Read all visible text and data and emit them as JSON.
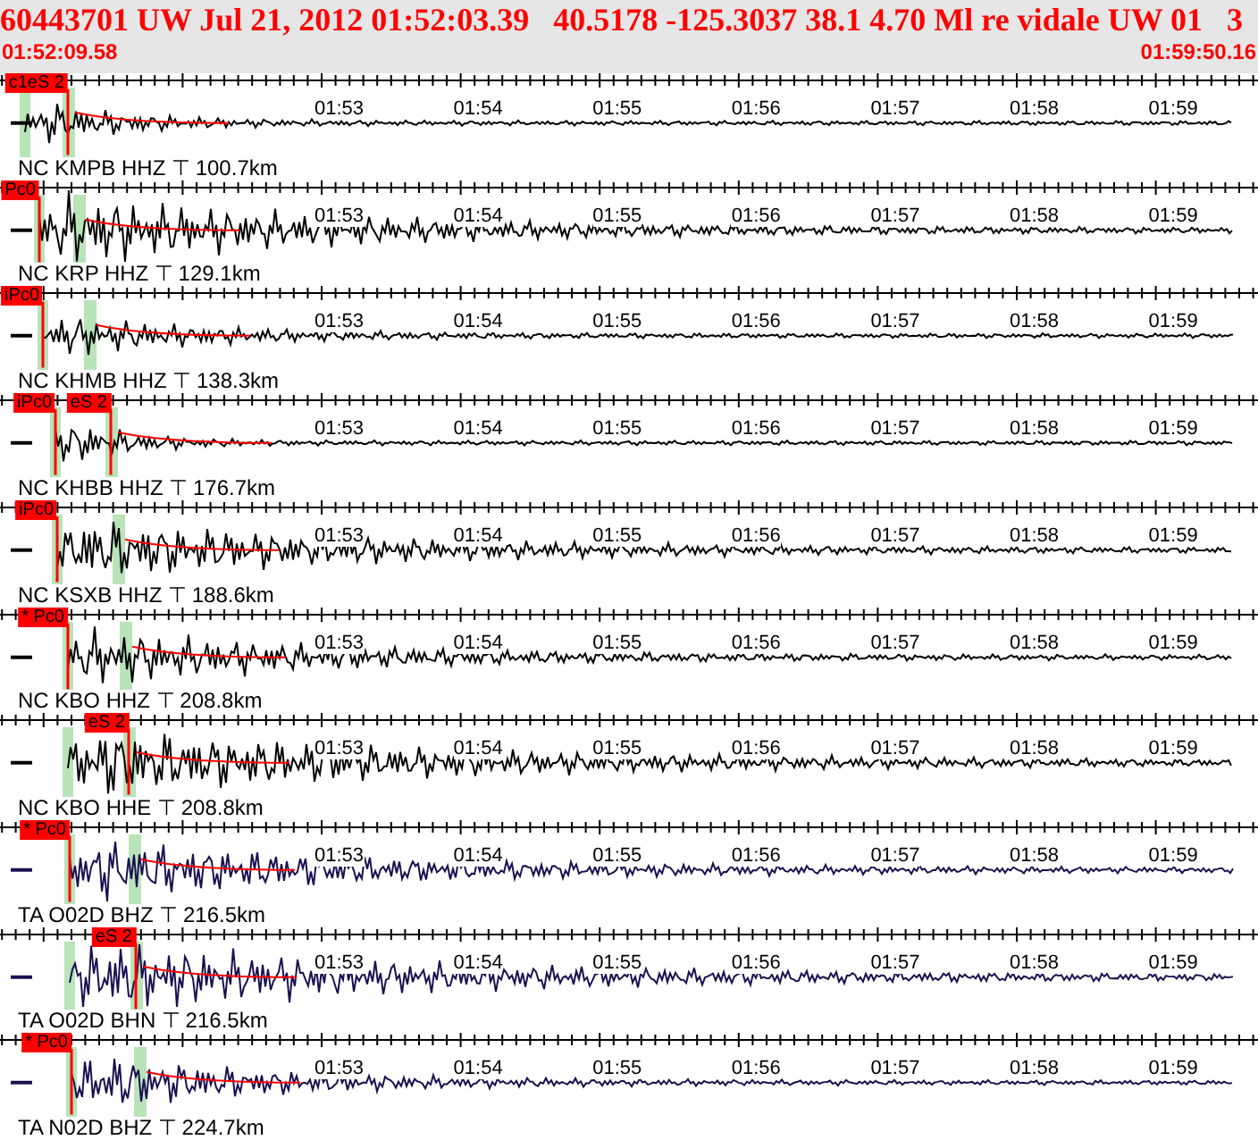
{
  "header": {
    "title": "60443701 UW Jul 21, 2012 01:52:03.39   40.5178 -125.3037 38.1 4.70 Ml re vidale UW 01   3",
    "start_time": "01:52:09.58",
    "end_time": "01:59:50.16"
  },
  "channels": [
    {
      "station": "NC KMPB HHZ ⊤ 100.7km",
      "color": "#000000",
      "picks": [
        {
          "kind": "s",
          "label": "c1eS 2"
        }
      ],
      "time_labels": [
        "01:53",
        "01:54",
        "01:55",
        "01:56",
        "01:57",
        "01:58",
        "01:59"
      ]
    },
    {
      "station": "NC KRP HHZ ⊤ 129.1km",
      "color": "#000000",
      "picks": [
        {
          "kind": "p",
          "label": "Pc0"
        }
      ],
      "time_labels": [
        "01:53",
        "01:54",
        "01:55",
        "01:56",
        "01:57",
        "01:58",
        "01:59"
      ]
    },
    {
      "station": "NC KHMB HHZ ⊤ 138.3km",
      "color": "#000000",
      "picks": [
        {
          "kind": "p",
          "label": "iPc0"
        }
      ],
      "time_labels": [
        "01:53",
        "01:54",
        "01:55",
        "01:56",
        "01:57",
        "01:58",
        "01:59"
      ]
    },
    {
      "station": "NC KHBB HHZ ⊤ 176.7km",
      "color": "#000000",
      "picks": [
        {
          "kind": "p",
          "label": "iPc0"
        },
        {
          "kind": "s",
          "label": "eS 2"
        }
      ],
      "time_labels": [
        "01:53",
        "01:54",
        "01:55",
        "01:56",
        "01:57",
        "01:58",
        "01:59"
      ]
    },
    {
      "station": "NC KSXB HHZ ⊤ 188.6km",
      "color": "#000000",
      "picks": [
        {
          "kind": "p",
          "label": "iPc0"
        }
      ],
      "time_labels": [
        "01:53",
        "01:54",
        "01:55",
        "01:56",
        "01:57",
        "01:58",
        "01:59"
      ]
    },
    {
      "station": "NC KBO HHZ ⊤ 208.8km",
      "color": "#000000",
      "picks": [
        {
          "kind": "p",
          "label": "* Pc0"
        }
      ],
      "time_labels": [
        "01:53",
        "01:54",
        "01:55",
        "01:56",
        "01:57",
        "01:58",
        "01:59"
      ]
    },
    {
      "station": "NC KBO HHE ⊤ 208.8km",
      "color": "#000000",
      "picks": [
        {
          "kind": "s",
          "label": "eS 2"
        }
      ],
      "time_labels": [
        "01:53",
        "01:54",
        "01:55",
        "01:56",
        "01:57",
        "01:58",
        "01:59"
      ]
    },
    {
      "station": "TA O02D BHZ ⊤ 216.5km",
      "color": "#1a1050",
      "picks": [
        {
          "kind": "p",
          "label": "* Pc0"
        }
      ],
      "time_labels": [
        "01:53",
        "01:54",
        "01:55",
        "01:56",
        "01:57",
        "01:58",
        "01:59"
      ]
    },
    {
      "station": "TA O02D BHN ⊤ 216.5km",
      "color": "#1a1050",
      "picks": [
        {
          "kind": "s",
          "label": "eS 2"
        }
      ],
      "time_labels": [
        "01:53",
        "01:54",
        "01:55",
        "01:56",
        "01:57",
        "01:58",
        "01:59"
      ]
    },
    {
      "station": "TA N02D BHZ ⊤ 224.7km",
      "color": "#1a1050",
      "picks": [
        {
          "kind": "p",
          "label": "* Pc0"
        }
      ],
      "time_labels": [
        "01:53",
        "01:54",
        "01:55",
        "01:56",
        "01:57",
        "01:58",
        "01:59"
      ]
    }
  ]
}
